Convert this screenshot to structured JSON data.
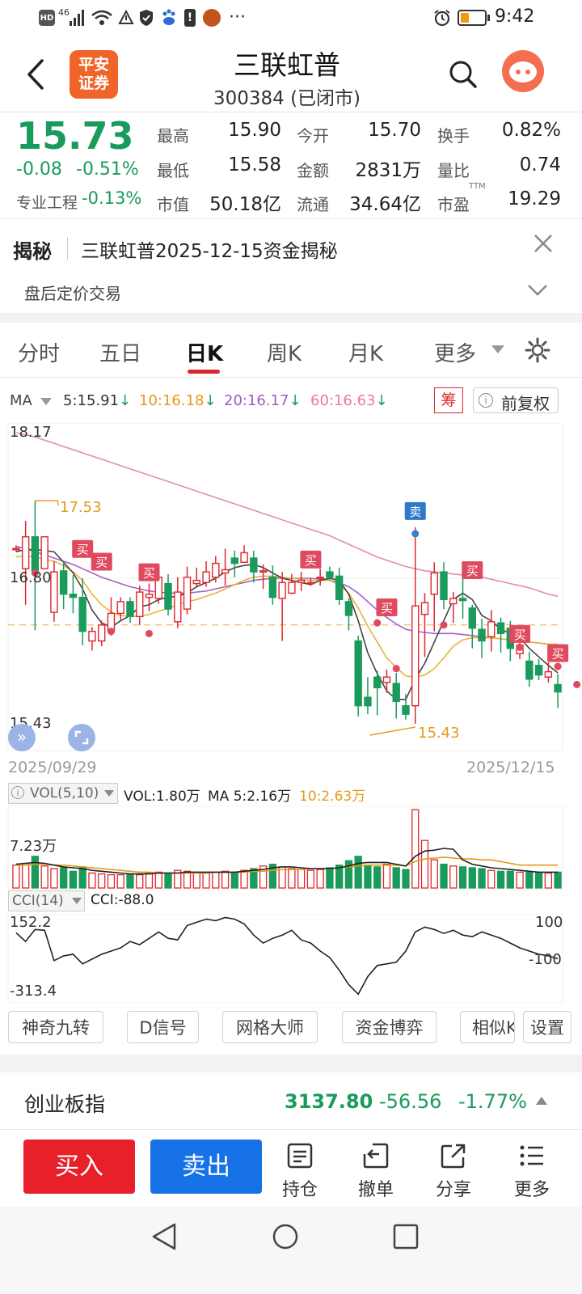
{
  "status_bar": {
    "left_icons": [
      "hd-icon",
      "signal-4g-icon",
      "wifi-icon",
      "data-saver-icon",
      "shield-icon",
      "baidu-icon",
      "alert-icon",
      "game-icon",
      "more-icon"
    ],
    "signal_text": "46",
    "more": "···",
    "time": "9:42"
  },
  "header": {
    "logo_line1": "平安",
    "logo_line2": "证券",
    "title": "三联虹普",
    "subtitle": "300384 (已闭市)"
  },
  "quote": {
    "price": "15.73",
    "change": "-0.08",
    "change_pct": "-0.51%",
    "sector_label": "专业工程",
    "sector_pct": "-0.13%",
    "rows": [
      [
        {
          "label": "最高",
          "value": "15.90",
          "color": "red"
        },
        {
          "label": "今开",
          "value": "15.70",
          "color": "green"
        },
        {
          "label": "换手",
          "value": "0.82%",
          "color": "dark"
        }
      ],
      [
        {
          "label": "最低",
          "value": "15.58",
          "color": "green"
        },
        {
          "label": "金额",
          "value": "2831万",
          "color": "dark"
        },
        {
          "label": "量比",
          "value": "0.74",
          "color": "dark"
        }
      ],
      [
        {
          "label": "市值",
          "value": "50.18亿",
          "color": "dark"
        },
        {
          "label": "流通",
          "value": "34.64亿",
          "color": "dark"
        },
        {
          "label": "市盈",
          "value": "19.29",
          "color": "dark"
        }
      ]
    ],
    "ttm": "TTM"
  },
  "news": {
    "tag": "揭秘",
    "headline": "三联虹普2025-12-15资金揭秘",
    "sub": "盘后定价交易"
  },
  "tabs": {
    "items": [
      "分时",
      "五日",
      "日K",
      "周K",
      "月K",
      "更多"
    ],
    "active": 2
  },
  "ma_bar": {
    "label": "MA",
    "ma5": "5:15.91",
    "ma10": "10:16.18",
    "ma20": "20:16.17",
    "ma60": "60:16.63",
    "arrow": "↓",
    "chip_btn": "筹",
    "adjust_btn": "前复权"
  },
  "chart_data": {
    "type": "candlestick",
    "y_top": "18.17",
    "y_mid": "16.80",
    "y_bottom": "15.43",
    "ylim": [
      15.43,
      18.17
    ],
    "ref_price": 16.36,
    "date_start": "2025/09/29",
    "date_end": "2025/12/15",
    "high_mark": "17.53",
    "low_mark": "15.43",
    "sell_label": "卖",
    "buy_label": "买",
    "candles": [
      [
        17.08,
        17.08,
        17.11,
        17.05
      ],
      [
        16.89,
        17.19,
        17.34,
        16.55
      ],
      [
        17.19,
        16.87,
        17.53,
        16.31
      ],
      [
        16.89,
        17.19,
        17.19,
        16.89
      ],
      [
        16.48,
        16.86,
        16.96,
        16.39
      ],
      [
        16.87,
        16.65,
        16.96,
        16.51
      ],
      [
        16.65,
        16.62,
        16.83,
        16.47
      ],
      [
        16.62,
        16.3,
        16.8,
        16.17
      ],
      [
        16.21,
        16.3,
        16.34,
        16.12
      ],
      [
        16.21,
        16.36,
        16.4,
        16.16
      ],
      [
        16.3,
        16.47,
        16.62,
        16.26
      ],
      [
        16.47,
        16.58,
        16.62,
        16.4
      ],
      [
        16.58,
        16.44,
        16.62,
        16.38
      ],
      [
        16.44,
        16.67,
        16.73,
        16.36
      ],
      [
        16.62,
        16.65,
        16.75,
        16.49
      ],
      [
        16.61,
        16.81,
        16.86,
        16.56
      ],
      [
        16.75,
        16.51,
        16.84,
        16.45
      ],
      [
        16.39,
        16.67,
        16.81,
        16.33
      ],
      [
        16.51,
        16.81,
        16.91,
        16.46
      ],
      [
        16.75,
        16.78,
        16.9,
        16.72
      ],
      [
        16.76,
        16.86,
        16.96,
        16.72
      ],
      [
        16.81,
        16.94,
        17.01,
        16.76
      ],
      [
        16.85,
        16.88,
        17.08,
        16.73
      ],
      [
        16.99,
        16.94,
        17.06,
        16.81
      ],
      [
        16.95,
        17.04,
        17.11,
        16.99
      ],
      [
        16.99,
        16.86,
        17.06,
        16.76
      ],
      [
        16.87,
        16.87,
        16.93,
        16.7
      ],
      [
        16.81,
        16.62,
        16.92,
        16.55
      ],
      [
        16.61,
        16.76,
        16.86,
        16.21
      ],
      [
        16.66,
        16.76,
        16.84,
        16.65
      ],
      [
        16.76,
        16.78,
        16.86,
        16.68
      ],
      [
        16.76,
        16.76,
        16.8,
        16.73
      ],
      [
        16.81,
        16.81,
        16.89,
        16.73
      ],
      [
        16.86,
        16.81,
        16.91,
        16.78
      ],
      [
        16.82,
        16.6,
        16.9,
        16.55
      ],
      [
        16.58,
        16.45,
        16.61,
        16.31
      ],
      [
        16.21,
        15.6,
        16.26,
        15.5
      ],
      [
        15.68,
        15.6,
        15.87,
        15.52
      ],
      [
        15.87,
        15.77,
        15.93,
        15.51
      ],
      [
        15.82,
        15.87,
        15.94,
        15.72
      ],
      [
        15.81,
        15.64,
        15.91,
        15.48
      ],
      [
        15.6,
        15.52,
        15.71,
        15.47
      ],
      [
        15.6,
        16.54,
        17.28,
        15.43
      ],
      [
        16.46,
        16.57,
        16.66,
        16.06
      ],
      [
        16.65,
        16.85,
        16.95,
        16.3
      ],
      [
        16.86,
        16.6,
        16.95,
        16.51
      ],
      [
        16.56,
        16.61,
        16.67,
        16.38
      ],
      [
        16.61,
        16.59,
        16.81,
        16.42
      ],
      [
        16.52,
        16.33,
        16.55,
        16.14
      ],
      [
        16.32,
        16.21,
        16.42,
        16.05
      ],
      [
        16.25,
        16.39,
        16.5,
        16.11
      ],
      [
        16.38,
        16.28,
        16.43,
        16.1
      ],
      [
        16.33,
        16.14,
        16.4,
        16.02
      ],
      [
        16.09,
        16.17,
        16.24,
        16.04
      ],
      [
        16.02,
        15.85,
        16.11,
        15.78
      ],
      [
        15.98,
        15.89,
        16.04,
        15.84
      ],
      [
        15.87,
        15.92,
        16.01,
        15.82
      ],
      [
        15.8,
        15.73,
        15.9,
        15.58
      ]
    ],
    "ma5": [
      17.05,
      17.07,
      17.07,
      17.06,
      17.05,
      16.95,
      16.85,
      16.7,
      16.5,
      16.38,
      16.34,
      16.4,
      16.45,
      16.53,
      16.55,
      16.6,
      16.62,
      16.63,
      16.66,
      16.72,
      16.76,
      16.8,
      16.86,
      16.9,
      16.92,
      16.93,
      16.9,
      16.85,
      16.8,
      16.78,
      16.76,
      16.74,
      16.78,
      16.8,
      16.78,
      16.65,
      16.4,
      16.1,
      15.9,
      15.74,
      15.66,
      15.66,
      15.85,
      16.0,
      16.2,
      16.4,
      16.6,
      16.66,
      16.6,
      16.45,
      16.4,
      16.32,
      16.28,
      16.24,
      16.14,
      16.06,
      15.98,
      15.91
    ],
    "ma10": [
      17.0,
      17.01,
      17.0,
      16.98,
      16.96,
      16.92,
      16.86,
      16.78,
      16.65,
      16.55,
      16.48,
      16.45,
      16.44,
      16.44,
      16.46,
      16.49,
      16.52,
      16.55,
      16.58,
      16.6,
      16.63,
      16.66,
      16.7,
      16.74,
      16.78,
      16.81,
      16.82,
      16.82,
      16.81,
      16.8,
      16.79,
      16.78,
      16.78,
      16.78,
      16.74,
      16.66,
      16.52,
      16.35,
      16.2,
      16.05,
      15.96,
      15.88,
      15.87,
      15.89,
      15.95,
      16.05,
      16.16,
      16.22,
      16.24,
      16.24,
      16.24,
      16.23,
      16.22,
      16.21,
      16.2,
      16.19,
      16.18,
      16.18
    ],
    "ma20": [
      17.1,
      17.08,
      17.05,
      17.02,
      16.99,
      16.96,
      16.93,
      16.89,
      16.85,
      16.81,
      16.78,
      16.75,
      16.72,
      16.7,
      16.68,
      16.67,
      16.66,
      16.66,
      16.66,
      16.67,
      16.68,
      16.7,
      16.72,
      16.74,
      16.76,
      16.78,
      16.79,
      16.8,
      16.8,
      16.8,
      16.8,
      16.8,
      16.79,
      16.78,
      16.76,
      16.72,
      16.66,
      16.58,
      16.5,
      16.43,
      16.37,
      16.32,
      16.3,
      16.29,
      16.28,
      16.28,
      16.28,
      16.27,
      16.26,
      16.25,
      16.24,
      16.23,
      16.22,
      16.21,
      16.2,
      16.19,
      16.18,
      16.17
    ],
    "ma60": [
      18.17,
      18.15,
      18.13,
      18.1,
      18.07,
      18.04,
      18.01,
      17.98,
      17.95,
      17.92,
      17.89,
      17.86,
      17.83,
      17.8,
      17.77,
      17.74,
      17.71,
      17.68,
      17.65,
      17.62,
      17.59,
      17.56,
      17.53,
      17.5,
      17.47,
      17.44,
      17.41,
      17.38,
      17.35,
      17.32,
      17.29,
      17.26,
      17.23,
      17.2,
      17.16,
      17.12,
      17.08,
      17.04,
      17.0,
      16.97,
      16.94,
      16.91,
      16.89,
      16.87,
      16.86,
      16.85,
      16.84,
      16.83,
      16.82,
      16.81,
      16.79,
      16.77,
      16.75,
      16.73,
      16.71,
      16.68,
      16.65,
      16.63
    ],
    "buy_signals": [
      [
        7,
        17.0
      ],
      [
        9,
        16.88
      ],
      [
        14,
        16.78
      ],
      [
        31,
        16.9
      ],
      [
        39,
        16.45
      ],
      [
        48,
        16.8
      ],
      [
        53,
        16.2
      ],
      [
        57,
        16.02
      ]
    ],
    "sell_signals": [
      [
        42,
        17.28
      ]
    ],
    "marker_dots": [
      [
        2,
        16.85
      ],
      [
        10,
        16.3
      ],
      [
        14,
        16.28
      ],
      [
        38,
        16.38
      ],
      [
        40,
        15.95
      ],
      [
        45,
        16.36
      ],
      [
        53,
        16.15
      ],
      [
        57,
        15.97
      ],
      [
        59,
        15.8
      ],
      [
        60,
        15.53
      ]
    ]
  },
  "volume": {
    "label": "VOL(5,10)",
    "text": "VOL:1.80万",
    "ma5_text": "MA 5:2.16万",
    "ma10_text": "10:2.63万",
    "y_label": "7.23万",
    "max": 7.23,
    "bars": [
      2.6,
      2.8,
      3.6,
      2.5,
      2.2,
      2.3,
      1.9,
      2.4,
      1.7,
      1.6,
      1.5,
      1.5,
      1.6,
      1.5,
      1.7,
      1.8,
      1.7,
      2.0,
      1.9,
      1.8,
      1.7,
      1.8,
      1.9,
      1.8,
      2.0,
      2.2,
      2.5,
      2.7,
      2.4,
      2.2,
      2.1,
      2.0,
      2.1,
      2.3,
      2.6,
      3.1,
      3.6,
      2.6,
      2.4,
      2.7,
      2.3,
      2.1,
      8.9,
      5.4,
      3.2,
      2.7,
      2.5,
      2.4,
      2.3,
      2.2,
      2.0,
      1.9,
      1.9,
      1.8,
      1.8,
      1.7,
      1.7,
      1.8
    ],
    "ma5": [
      2.7,
      2.8,
      2.9,
      2.8,
      2.6,
      2.4,
      2.3,
      2.2,
      2.0,
      1.9,
      1.8,
      1.7,
      1.6,
      1.6,
      1.6,
      1.7,
      1.7,
      1.7,
      1.8,
      1.8,
      1.8,
      1.8,
      1.8,
      1.8,
      1.9,
      2.0,
      2.1,
      2.3,
      2.4,
      2.4,
      2.3,
      2.2,
      2.2,
      2.2,
      2.3,
      2.5,
      2.8,
      2.9,
      2.9,
      2.9,
      2.7,
      2.5,
      3.6,
      4.2,
      4.3,
      4.5,
      4.4,
      3.2,
      2.7,
      2.5,
      2.3,
      2.2,
      2.1,
      2.0,
      1.9,
      1.8,
      1.8,
      1.8
    ],
    "ma10": [
      2.6,
      2.6,
      2.7,
      2.7,
      2.6,
      2.6,
      2.5,
      2.4,
      2.3,
      2.2,
      2.1,
      2.0,
      1.9,
      1.8,
      1.8,
      1.7,
      1.7,
      1.7,
      1.7,
      1.7,
      1.7,
      1.8,
      1.8,
      1.8,
      1.8,
      1.9,
      1.9,
      2.0,
      2.1,
      2.1,
      2.1,
      2.2,
      2.2,
      2.2,
      2.3,
      2.4,
      2.5,
      2.6,
      2.6,
      2.6,
      2.6,
      2.5,
      3.0,
      3.3,
      3.4,
      3.5,
      3.4,
      3.3,
      3.3,
      3.2,
      3.2,
      3.0,
      2.8,
      2.6,
      2.6,
      2.6,
      2.6,
      2.6
    ]
  },
  "cci": {
    "label": "CCI(14)",
    "text": "CCI:-88.0",
    "y_top": "152.2",
    "y_bottom": "-313.4",
    "ref_top": "100",
    "ref_bottom": "-100",
    "range": [
      -313.4,
      152.2
    ],
    "values": [
      75,
      20,
      95,
      90,
      -100,
      -70,
      -60,
      -120,
      -90,
      -60,
      -40,
      -20,
      20,
      0,
      40,
      80,
      40,
      30,
      120,
      140,
      160,
      150,
      170,
      160,
      130,
      60,
      10,
      40,
      60,
      90,
      30,
      10,
      -40,
      -80,
      -160,
      -250,
      -310,
      -200,
      -130,
      -120,
      -110,
      -40,
      80,
      110,
      95,
      70,
      90,
      60,
      50,
      80,
      60,
      40,
      10,
      -20,
      -40,
      -60,
      -70,
      -88
    ]
  },
  "tools": [
    "神奇九转",
    "D信号",
    "网格大师",
    "资金博弈",
    "相似K",
    "设置"
  ],
  "index_bar": {
    "name": "创业板指",
    "value": "3137.80",
    "change": "-56.56",
    "pct": "-1.77%"
  },
  "bottom": {
    "buy": "买入",
    "sell": "卖出",
    "actions": [
      {
        "icon": "holdings-icon",
        "label": "持仓"
      },
      {
        "icon": "cancel-order-icon",
        "label": "撤单"
      },
      {
        "icon": "share-icon",
        "label": "分享"
      },
      {
        "icon": "menu-icon",
        "label": "更多"
      }
    ]
  },
  "colors": {
    "up": "#e0262d",
    "down": "#1a9b5c",
    "ma5": "#444444",
    "ma10": "#e8b33a",
    "ma20": "#a862c9",
    "ma60": "#e48bb2",
    "buy_btn": "#e8202a",
    "sell_btn": "#1672e6"
  }
}
